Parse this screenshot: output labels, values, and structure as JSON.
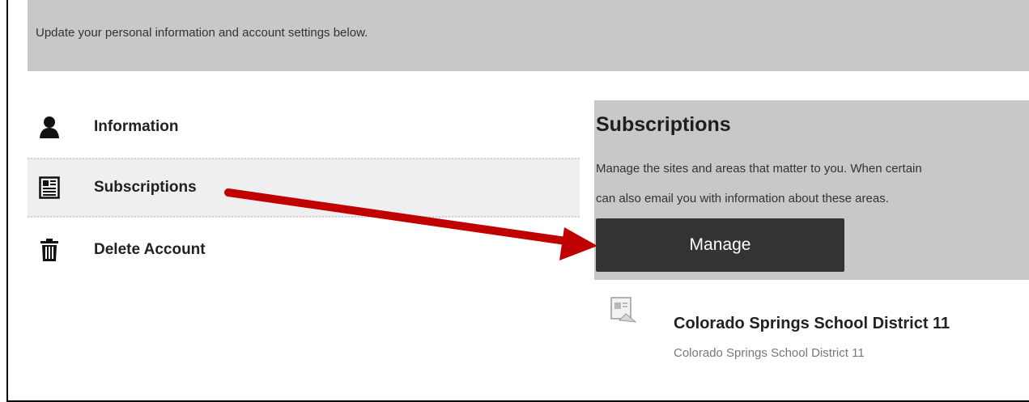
{
  "header": {
    "description": "Update your personal information and account settings below."
  },
  "sidebar": {
    "items": [
      {
        "label": "Information",
        "icon": "person-icon"
      },
      {
        "label": "Subscriptions",
        "icon": "newspaper-icon",
        "active": true
      },
      {
        "label": "Delete Account",
        "icon": "trash-icon"
      }
    ]
  },
  "panel": {
    "title": "Subscriptions",
    "description_line1": "Manage the sites and areas that matter to you. When certain",
    "description_line2": "can also email you with information about these areas.",
    "button_label": "Manage"
  },
  "subscriptions": [
    {
      "title": "Colorado Springs School District 11",
      "subtitle": "Colorado Springs School District 11",
      "icon": "site-thumbnail-icon"
    }
  ],
  "colors": {
    "banner": "#c8c8c8",
    "button": "#333333",
    "annotation_arrow": "#c00000"
  }
}
